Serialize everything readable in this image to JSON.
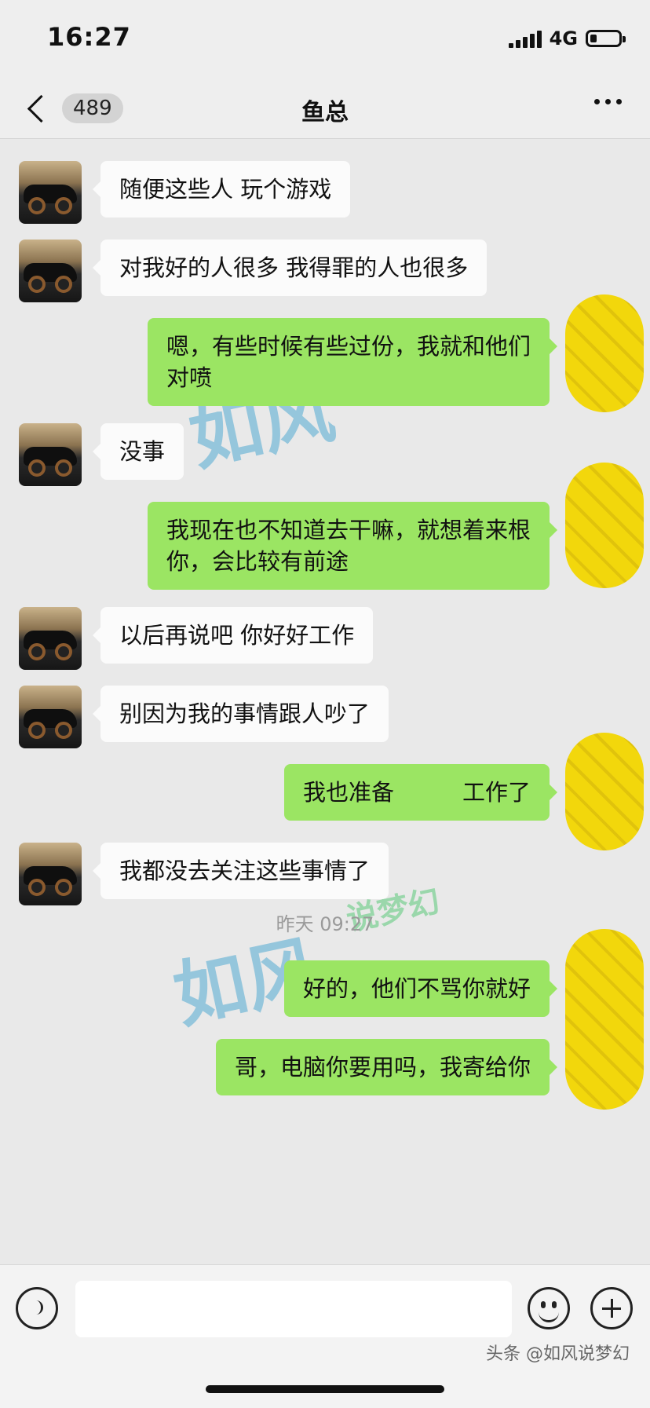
{
  "status": {
    "time": "16:27",
    "network": "4G"
  },
  "nav": {
    "unread_count": "489",
    "title": "鱼总"
  },
  "messages": [
    {
      "side": "left",
      "text": "随便这些人 玩个游戏"
    },
    {
      "side": "left",
      "text": "对我好的人很多 我得罪的人也很多"
    },
    {
      "side": "right",
      "text": "嗯，有些时候有些过份，我就和他们\n对喷"
    },
    {
      "side": "left",
      "text": "没事"
    },
    {
      "side": "right",
      "text": "我现在也不知道去干嘛，就想着来根\n你，会比较有前途"
    },
    {
      "side": "left",
      "text": "以后再说吧 你好好工作"
    },
    {
      "side": "left",
      "text": "别因为我的事情跟人吵了"
    },
    {
      "side": "right",
      "text": "我也准备　　　工作了"
    },
    {
      "side": "left",
      "text": "我都没去关注这些事情了"
    },
    {
      "side": "right",
      "text": "好的，他们不骂你就好"
    },
    {
      "side": "right",
      "text": "哥，电脑你要用吗，我寄给你"
    }
  ],
  "timestamp": "昨天 09:27",
  "watermark": {
    "main": "如风",
    "sub": "说梦幻"
  },
  "footer": {
    "source": "头条 @如风说梦幻"
  }
}
